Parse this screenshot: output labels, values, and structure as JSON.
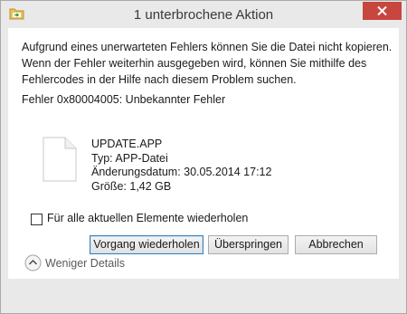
{
  "window": {
    "title": "1 unterbrochene Aktion",
    "close_glyph": "✕"
  },
  "message": {
    "line1": "Aufgrund eines unerwarteten Fehlers können Sie die Datei nicht kopieren.",
    "line2": "Wenn der Fehler weiterhin ausgegeben wird, können Sie mithilfe des",
    "line3": "Fehlercodes in der Hilfe nach diesem Problem suchen.",
    "error_code": "Fehler 0x80004005: Unbekannter Fehler"
  },
  "file": {
    "icon": "document-icon",
    "name": "UPDATE.APP",
    "type": "Typ: APP-Datei",
    "modified": "Änderungsdatum: 30.05.2014 17:12",
    "size": "Größe: 1,42 GB"
  },
  "checkbox": {
    "label": "Für alle aktuellen Elemente wiederholen",
    "checked": false
  },
  "buttons": {
    "retry": "Vorgang wiederholen",
    "skip": "Überspringen",
    "cancel": "Abbrechen"
  },
  "details": {
    "label": "Weniger Details",
    "icon": "chevron-up-icon"
  },
  "colors": {
    "close_button": "#c7463d",
    "title_bar": "#e9e9e9",
    "content_background": "#ffffff",
    "default_button_border": "#3c7fb1"
  }
}
